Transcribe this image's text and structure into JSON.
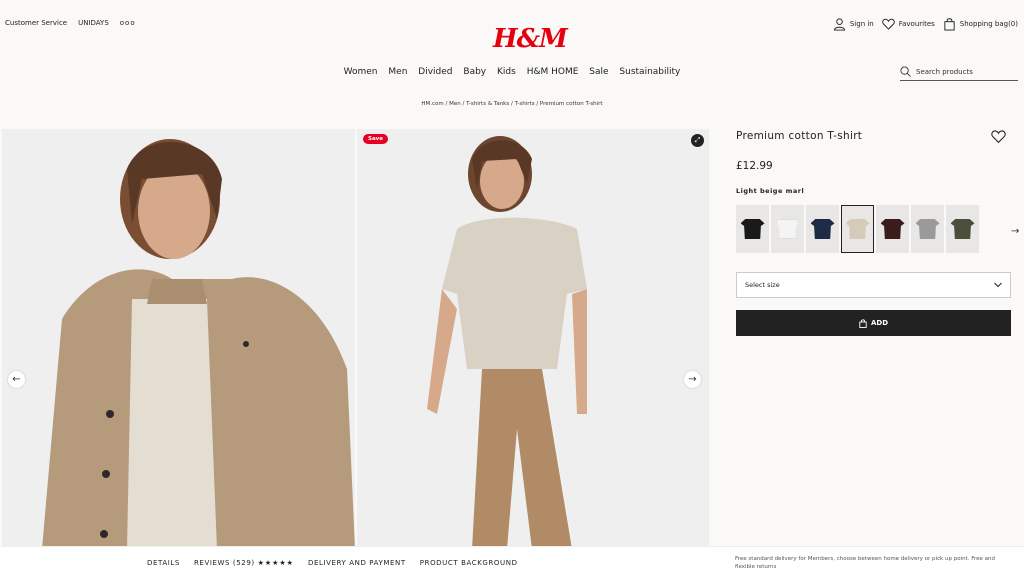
{
  "header": {
    "top_left": {
      "customer_service": "Customer Service",
      "unidays": "UNIDAYS",
      "more": "ooo"
    },
    "logo": "H&M",
    "top_right": {
      "sign_in": "Sign in",
      "favourites": "Favourites",
      "shopping_bag": "Shopping bag(0)"
    }
  },
  "nav": {
    "items": [
      "Women",
      "Men",
      "Divided",
      "Baby",
      "Kids",
      "H&M HOME",
      "Sale",
      "Sustainability"
    ]
  },
  "search": {
    "placeholder": "Search products"
  },
  "breadcrumb": "HM.com / Men / T-shirts & Tanks / T-shirts / Premium cotton T-shirt",
  "gallery": {
    "save_label": "Save",
    "prev_arrow": "←",
    "next_arrow": "→"
  },
  "product": {
    "title": "Premium cotton T-shirt",
    "price": "£12.99",
    "color_name": "Light beige marl",
    "swatches": [
      {
        "color": "#1a1a1a"
      },
      {
        "color": "#f4f4f4"
      },
      {
        "color": "#1f2a44"
      },
      {
        "color": "#d6cbb8",
        "selected": true
      },
      {
        "color": "#3a1c1c"
      },
      {
        "color": "#9a9a9a"
      },
      {
        "color": "#4a4f3c"
      }
    ],
    "size_select": "Select size",
    "add_label": "ADD"
  },
  "bottom": {
    "tabs": {
      "details": "DETAILS",
      "reviews": "REVIEWS (529)",
      "stars": "★★★★★",
      "delivery": "DELIVERY AND PAYMENT",
      "background": "PRODUCT BACKGROUND"
    },
    "delivery_note": "Free standard delivery for Members, choose between home delivery or pick up point. Free and flexible returns"
  },
  "colors": {
    "brand_red": "#e50010",
    "pinterest_red": "#e60023"
  }
}
